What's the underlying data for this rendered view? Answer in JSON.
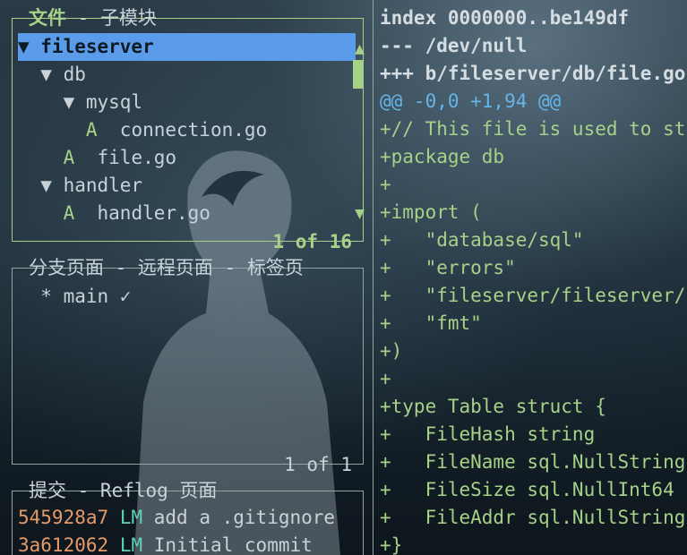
{
  "files_pane": {
    "title_active": "文件",
    "title_sep": " - ",
    "title_other": "子模块",
    "count": "1 of 16",
    "items": [
      {
        "text": "▼ fileserver"
      },
      {
        "text": "  ▼ db"
      },
      {
        "text": "    ▼ mysql"
      },
      {
        "text": "      A  connection.go"
      },
      {
        "text": "    A  file.go"
      },
      {
        "text": "  ▼ handler"
      },
      {
        "text": "    A  handler.go"
      }
    ]
  },
  "branches_pane": {
    "title": "分支页面 - 远程页面 - 标签页",
    "items": [
      {
        "text": "  * main ✓"
      }
    ],
    "count": "1 of 1"
  },
  "commits_pane": {
    "title": "提交 - Reflog 页面",
    "items": [
      {
        "hash": "545928a7",
        "author": "LM",
        "message": "add a .gitignore"
      },
      {
        "hash": "3a612062",
        "author": "LM",
        "message": "Initial commit"
      }
    ]
  },
  "diff": {
    "lines": [
      {
        "text": "index 0000000..be149df",
        "kind": "head"
      },
      {
        "text": "--- /dev/null",
        "kind": "head"
      },
      {
        "text": "+++ b/fileserver/db/file.go",
        "kind": "head"
      },
      {
        "text": "@@ -0,0 +1,94 @@",
        "kind": "hunk"
      },
      {
        "text": "+// This file is used to st",
        "kind": "add"
      },
      {
        "text": "+package db",
        "kind": "add"
      },
      {
        "text": "+",
        "kind": "add"
      },
      {
        "text": "+import (",
        "kind": "add"
      },
      {
        "text": "+   \"database/sql\"",
        "kind": "add"
      },
      {
        "text": "+   \"errors\"",
        "kind": "add"
      },
      {
        "text": "+   \"fileserver/fileserver/",
        "kind": "add"
      },
      {
        "text": "+   \"fmt\"",
        "kind": "add"
      },
      {
        "text": "+)",
        "kind": "add"
      },
      {
        "text": "+",
        "kind": "add"
      },
      {
        "text": "+type Table struct {",
        "kind": "add"
      },
      {
        "text": "+   FileHash string",
        "kind": "add"
      },
      {
        "text": "+   FileName sql.NullString",
        "kind": "add"
      },
      {
        "text": "+   FileSize sql.NullInt64",
        "kind": "add"
      },
      {
        "text": "+   FileAddr sql.NullString",
        "kind": "add"
      },
      {
        "text": "+}",
        "kind": "add"
      }
    ]
  },
  "colors": {
    "active_border": "#a6d189",
    "selection": "#5a9bea",
    "hunk": "#64b5e8",
    "hash": "#e59a67"
  }
}
